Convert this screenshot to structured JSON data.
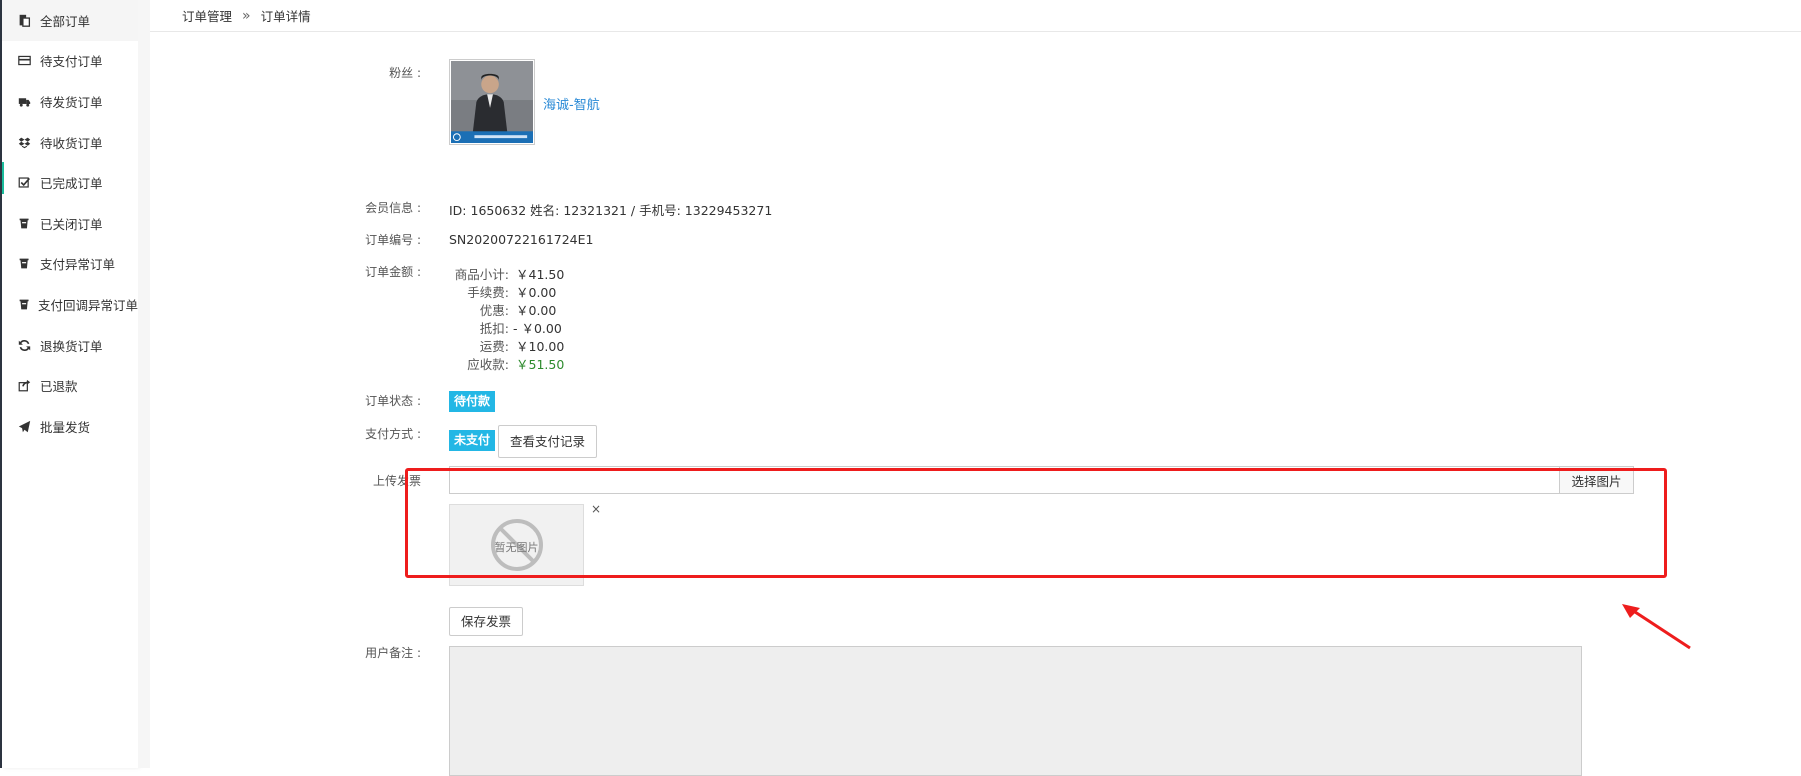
{
  "sidebar": {
    "items": [
      {
        "label": "全部订单",
        "icon": "order-list-icon"
      },
      {
        "label": "待支付订单",
        "icon": "credit-card-icon"
      },
      {
        "label": "待发货订单",
        "icon": "truck-icon"
      },
      {
        "label": "待收货订单",
        "icon": "dropbox-icon"
      },
      {
        "label": "已完成订单",
        "icon": "check-square-icon"
      },
      {
        "label": "已关闭订单",
        "icon": "coffee-cup-icon"
      },
      {
        "label": "支付异常订单",
        "icon": "coffee-cup-icon"
      },
      {
        "label": "支付回调异常订单",
        "icon": "coffee-cup-icon"
      },
      {
        "label": "退换货订单",
        "icon": "refresh-icon"
      },
      {
        "label": "已退款",
        "icon": "share-icon"
      },
      {
        "label": "批量发货",
        "icon": "paper-plane-icon"
      }
    ]
  },
  "breadcrumb": {
    "root": "订单管理",
    "separator": "»",
    "current": "订单详情"
  },
  "detail": {
    "fan_label": "粉丝 :",
    "fan_name": "海诚-智航",
    "member_label": "会员信息 :",
    "member_value": "ID: 1650632 姓名: 12321321 / 手机号: 13229453271",
    "order_no_label": "订单编号 :",
    "order_no": "SN20200722161724E1",
    "amount_label": "订单金额 :",
    "amounts": [
      {
        "key": "商品小计:",
        "value": "￥41.50"
      },
      {
        "key": "手续费:",
        "value": "￥0.00"
      },
      {
        "key": "优惠:",
        "value": "￥0.00"
      },
      {
        "key": "抵扣:",
        "value": "- ￥0.00"
      },
      {
        "key": "运费:",
        "value": "￥10.00"
      },
      {
        "key": "应收款:",
        "value": "￥51.50"
      }
    ],
    "status_label": "订单状态 :",
    "status_badge": "待付款",
    "payment_label": "支付方式 :",
    "payment_badge": "未支付",
    "payment_record_button": "查看支付记录",
    "invoice_label": "上传发票",
    "choose_image_button": "选择图片",
    "no_image_text": "暂无图片",
    "close_symbol": "×",
    "save_invoice_button": "保存发票",
    "remark_label": "用户备注 :"
  },
  "colors": {
    "accent": "#1abc9c",
    "badge": "#23b7e5",
    "link": "#2a8ad6",
    "highlight": "#ee1d1d",
    "receivable": "#2e8b2e"
  }
}
